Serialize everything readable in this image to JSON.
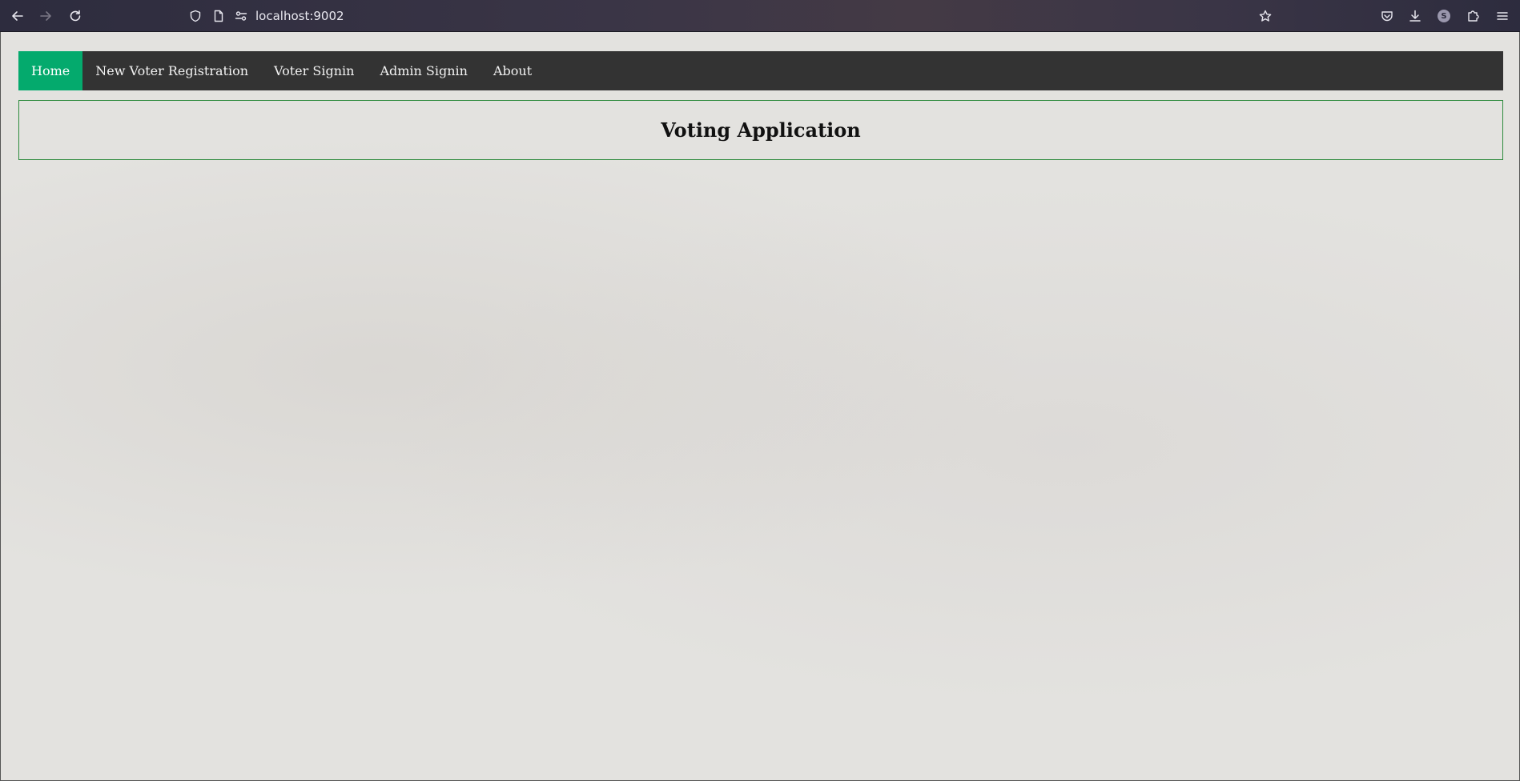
{
  "browser": {
    "url": "localhost:9002",
    "profile_initial": "S"
  },
  "icons": {
    "back": "arrow-left-icon",
    "forward": "arrow-right-icon",
    "reload": "reload-icon",
    "shield": "shield-icon",
    "page": "page-icon",
    "permissions": "permissions-icon",
    "bookmark": "star-icon",
    "pocket": "pocket-icon",
    "downloads": "download-icon",
    "extensions": "puzzle-icon",
    "menu": "hamburger-menu-icon"
  },
  "nav": {
    "items": [
      {
        "label": "Home",
        "active": true
      },
      {
        "label": "New Voter Registration",
        "active": false
      },
      {
        "label": "Voter Signin",
        "active": false
      },
      {
        "label": "Admin Signin",
        "active": false
      },
      {
        "label": "About",
        "active": false
      }
    ]
  },
  "header": {
    "title": "Voting Application"
  },
  "colors": {
    "nav_background": "#333333",
    "nav_active": "#04aa6d",
    "title_border": "#2e8b3e",
    "page_background": "#e3e2df"
  }
}
